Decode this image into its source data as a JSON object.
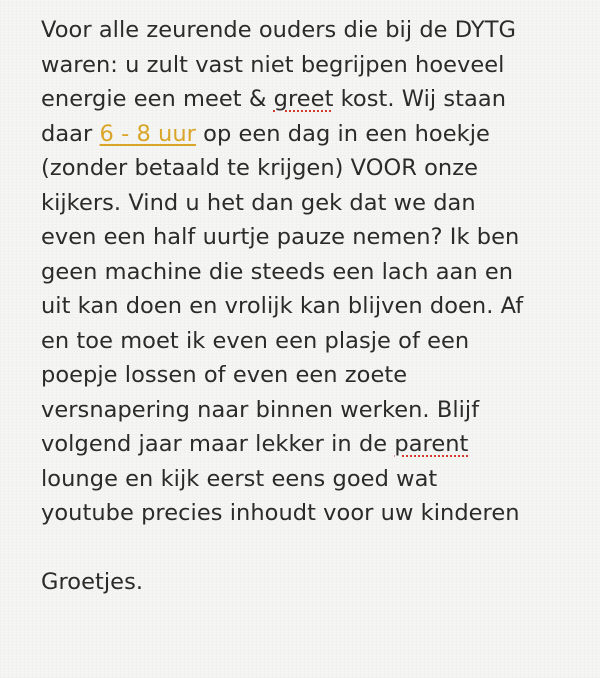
{
  "note": {
    "lines": [
      {
        "text": "Voor alle zeurende ouders die bij de DYTG"
      },
      {
        "text": "waren: u zult vast niet begrijpen hoeveel"
      },
      {
        "before": "energie een meet & ",
        "misspelled": "greet",
        "after": " kost. Wij staan"
      },
      {
        "before": "daar ",
        "link": "6 - 8 uur",
        "after": " op een dag in een hoekje"
      },
      {
        "text": "(zonder betaald te krijgen) VOOR onze"
      },
      {
        "text": "kijkers. Vind u het dan gek dat we dan"
      },
      {
        "text": "even een half uurtje pauze nemen? Ik ben"
      },
      {
        "text": "geen machine die steeds een lach aan en"
      },
      {
        "text": "uit kan doen en vrolijk kan blijven doen. Af"
      },
      {
        "text": "en toe moet ik even een plasje of een"
      },
      {
        "text": "poepje lossen of even een zoete"
      },
      {
        "text": "versnapering naar binnen werken. Blijf"
      },
      {
        "before": "volgend jaar maar lekker in de ",
        "misspelled": "parent",
        "after": ""
      },
      {
        "text": "lounge en kijk eerst eens goed wat"
      },
      {
        "text": "youtube precies inhoudt voor uw kinderen"
      }
    ],
    "signoff": "Groetjes."
  },
  "colors": {
    "background": "#f5f5f3",
    "text": "#2b2b2b",
    "link": "#d9a62a",
    "spellcheck_underline": "#d23a2a"
  }
}
